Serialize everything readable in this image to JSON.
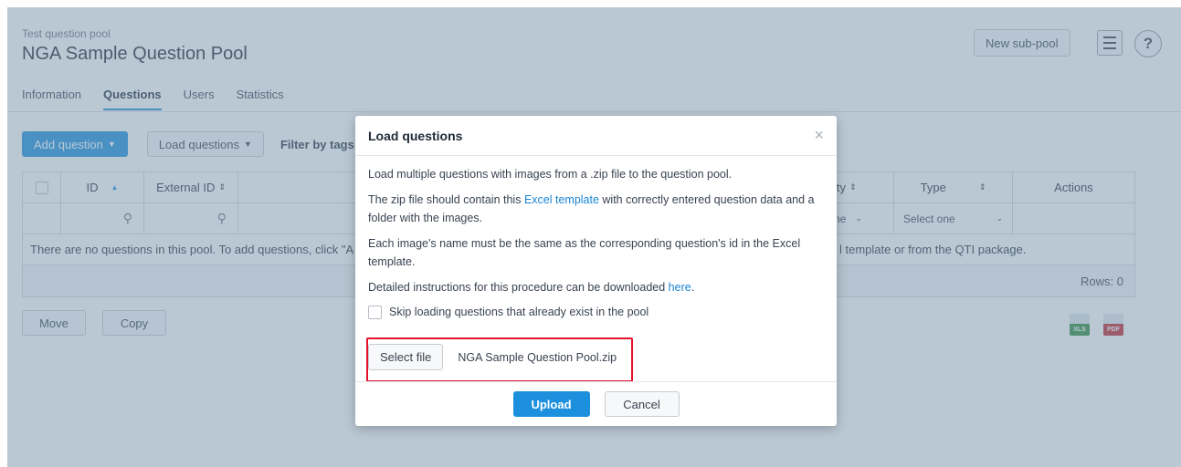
{
  "header": {
    "subtitle": "Test question pool",
    "title": "NGA Sample Question Pool",
    "new_subpool_label": "New sub-pool",
    "help_label": "?"
  },
  "tabs": [
    {
      "label": "Information",
      "active": false
    },
    {
      "label": "Questions",
      "active": true
    },
    {
      "label": "Users",
      "active": false
    },
    {
      "label": "Statistics",
      "active": false
    }
  ],
  "toolbar": {
    "add_question_label": "Add question",
    "load_questions_label": "Load questions",
    "filter_by_tags_label": "Filter by tags:"
  },
  "grid": {
    "columns": {
      "id": "ID",
      "external_id": "External ID",
      "difficulty_fragment": "lty",
      "type": "Type",
      "actions": "Actions"
    },
    "filters": {
      "difficulty_fragment": "ne",
      "type_placeholder": "Select one"
    },
    "empty_message_left": "There are no questions in this pool. To add questions, click \"A",
    "empty_message_right": "l template or from the QTI package.",
    "rows_label": "Rows: 0"
  },
  "bottom": {
    "move_label": "Move",
    "copy_label": "Copy",
    "xls_label": "XLS",
    "pdf_label": "PDF"
  },
  "modal": {
    "title": "Load questions",
    "close_glyph": "×",
    "line1": "Load multiple questions with images from a .zip file to the question pool.",
    "line2_pre": "The zip file should contain this ",
    "line2_link": "Excel template",
    "line2_post": " with correctly entered question data and a folder with the images.",
    "line3": "Each image's name must be the same as the corresponding question's id in the Excel template.",
    "line4_pre": "Detailed instructions for this procedure can be downloaded ",
    "line4_link": "here",
    "line4_post": ".",
    "skip_label": "Skip loading questions that already exist in the pool",
    "select_file_label": "Select file",
    "file_name": "NGA Sample Question Pool.zip",
    "upload_label": "Upload",
    "cancel_label": "Cancel"
  },
  "colors": {
    "accent": "#1c8fdd",
    "highlight": "#e4132b",
    "overlay": "#7692aa"
  }
}
